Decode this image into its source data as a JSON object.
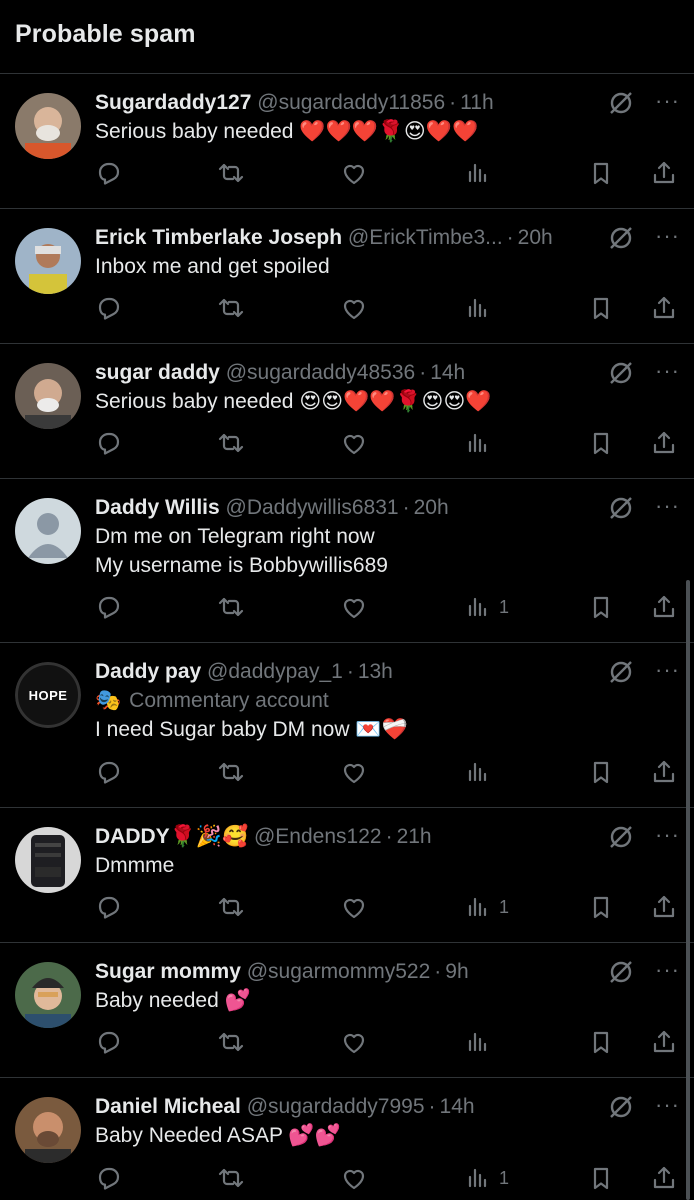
{
  "header": {
    "title": "Probable spam"
  },
  "posts": [
    {
      "name": "Sugardaddy127",
      "handle": "@sugardaddy11856",
      "sep": "·",
      "time": "11h",
      "text": "Serious baby needed ❤️❤️❤️🌹😍❤️❤️",
      "label": "",
      "views": ""
    },
    {
      "name": "Erick Timberlake Joseph",
      "handle": "@ErickTimbe3...",
      "sep": "·",
      "time": "20h",
      "text": "Inbox me and get spoiled",
      "label": "",
      "views": ""
    },
    {
      "name": "sugar daddy",
      "handle": "@sugardaddy48536",
      "sep": "·",
      "time": "14h",
      "text": "Serious baby needed 😍😍❤️❤️🌹😍😍❤️",
      "label": "",
      "views": ""
    },
    {
      "name": "Daddy Willis",
      "handle": "@Daddywillis6831",
      "sep": "·",
      "time": "20h",
      "text": "Dm me on Telegram right now\nMy username is Bobbywillis689",
      "label": "",
      "views": "1"
    },
    {
      "name": "Daddy pay",
      "handle": "@daddypay_1",
      "sep": "·",
      "time": "13h",
      "text": "I need Sugar baby  DM now 💌❤️‍🩹",
      "label": "Commentary account",
      "views": "",
      "avatar_text": "HOPE"
    },
    {
      "name": "DADDY🌹🎉🥰",
      "handle": "@Endens122",
      "sep": "·",
      "time": "21h",
      "text": "Dmmme",
      "label": "",
      "views": "1"
    },
    {
      "name": "Sugar mommy",
      "handle": "@sugarmommy522",
      "sep": "·",
      "time": "9h",
      "text": "Baby needed 💕",
      "label": "",
      "views": ""
    },
    {
      "name": "Daniel Micheal",
      "handle": "@sugardaddy7995",
      "sep": "·",
      "time": "14h",
      "text": "Baby Needed ASAP 💕💕",
      "label": "",
      "views": "1"
    }
  ],
  "icons": {
    "reply": "reply-icon",
    "retweet": "retweet-icon",
    "like": "like-icon",
    "views": "views-icon",
    "bookmark": "bookmark-icon",
    "share": "share-icon",
    "grok": "grok-icon",
    "more": "more-icon",
    "label": "theater-masks-icon"
  },
  "colors": {
    "background": "#000000",
    "text": "#e7e9ea",
    "muted": "#71767b",
    "divider": "#2f3336"
  }
}
